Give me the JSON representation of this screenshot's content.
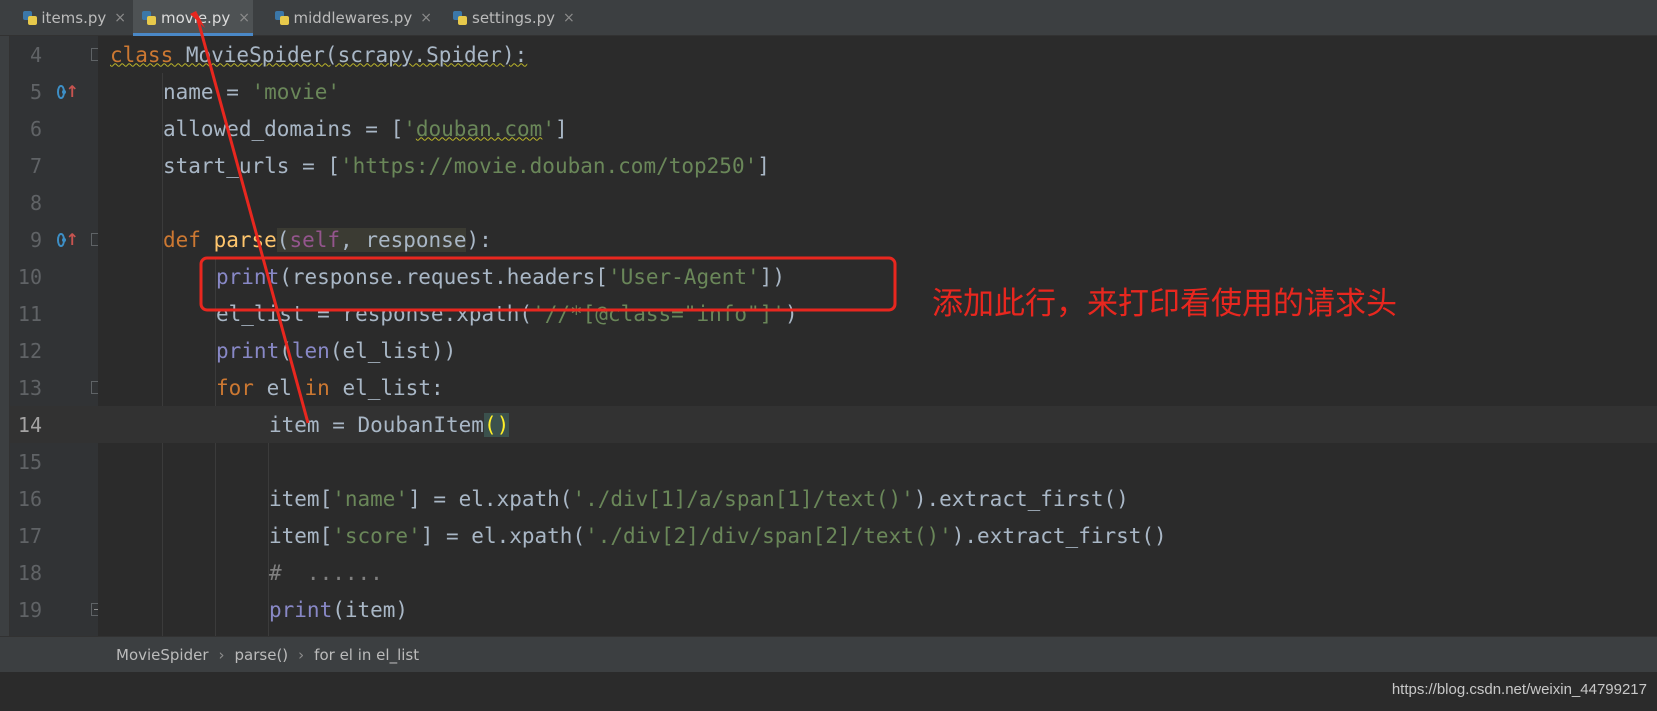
{
  "tabs": [
    {
      "label": "items.py",
      "close": "×",
      "active": false
    },
    {
      "label": "movie.py",
      "close": "×",
      "active": true
    },
    {
      "label": "middlewares.py",
      "close": "×",
      "active": false
    },
    {
      "label": "settings.py",
      "close": "×",
      "active": false
    }
  ],
  "lines": [
    {
      "no": "4"
    },
    {
      "no": "5"
    },
    {
      "no": "6"
    },
    {
      "no": "7"
    },
    {
      "no": "8"
    },
    {
      "no": "9"
    },
    {
      "no": "10"
    },
    {
      "no": "11"
    },
    {
      "no": "12"
    },
    {
      "no": "13"
    },
    {
      "no": "14"
    },
    {
      "no": "15"
    },
    {
      "no": "16"
    },
    {
      "no": "17"
    },
    {
      "no": "18"
    },
    {
      "no": "19"
    }
  ],
  "code": {
    "l4": {
      "kw": "class",
      "rest": " MovieSpider(scrapy.Spider):"
    },
    "l5": {
      "a": "name = ",
      "s": "'movie'"
    },
    "l6": {
      "a": "allowed_domains = [",
      "s1": "'",
      "s2": "douban.com",
      "s3": "'",
      "b": "]"
    },
    "l7": {
      "a": "start_urls = [",
      "s": "'https://movie.douban.com/top250'",
      "b": "]"
    },
    "l9": {
      "kw": "def",
      "a": " parse",
      "p1": "(",
      "self": "self",
      "p2": ", response",
      "p3": "):"
    },
    "l10": {
      "bi": "print",
      "a": "(response.request.headers[",
      "s": "'User-Agent'",
      "b": "])"
    },
    "l11": {
      "a": "el_list = response.xpath(",
      "s": "'//*[@class=\"info\"]'",
      "b": ")"
    },
    "l12": {
      "bi": "print",
      "a": "(",
      "bi2": "len",
      "b": "(el_list))"
    },
    "l13": {
      "kw": "for",
      "a": " el ",
      "kw2": "in",
      "b": " el_list:"
    },
    "l14": {
      "a": "item = DoubanItem",
      "br": "()"
    },
    "l16": {
      "a": "item[",
      "s": "'name'",
      "b": "] = el.xpath(",
      "s2": "'./div[1]/a/span[1]/text()'",
      "c": ").extract_first()"
    },
    "l17": {
      "a": "item[",
      "s": "'score'",
      "b": "] = el.xpath(",
      "s2": "'./div[2]/div/span[2]/text()'",
      "c": ").extract_first()"
    },
    "l18": {
      "cm": "#  ......"
    },
    "l19": {
      "bi": "print",
      "a": "(item)"
    }
  },
  "breadcrumb": [
    "MovieSpider",
    "parse()",
    "for el in el_list"
  ],
  "breadcrumb_sep": "›",
  "annotation": {
    "note": "添加此行，来打印看使用的请求头",
    "color": "#e8271f"
  },
  "watermark": "https://blog.csdn.net/weixin_44799217",
  "colors": {
    "keyword": "#cc7832",
    "string": "#6a8759",
    "builtin": "#8888c6",
    "default": "#a9b7c6",
    "background": "#2b2b2b"
  }
}
